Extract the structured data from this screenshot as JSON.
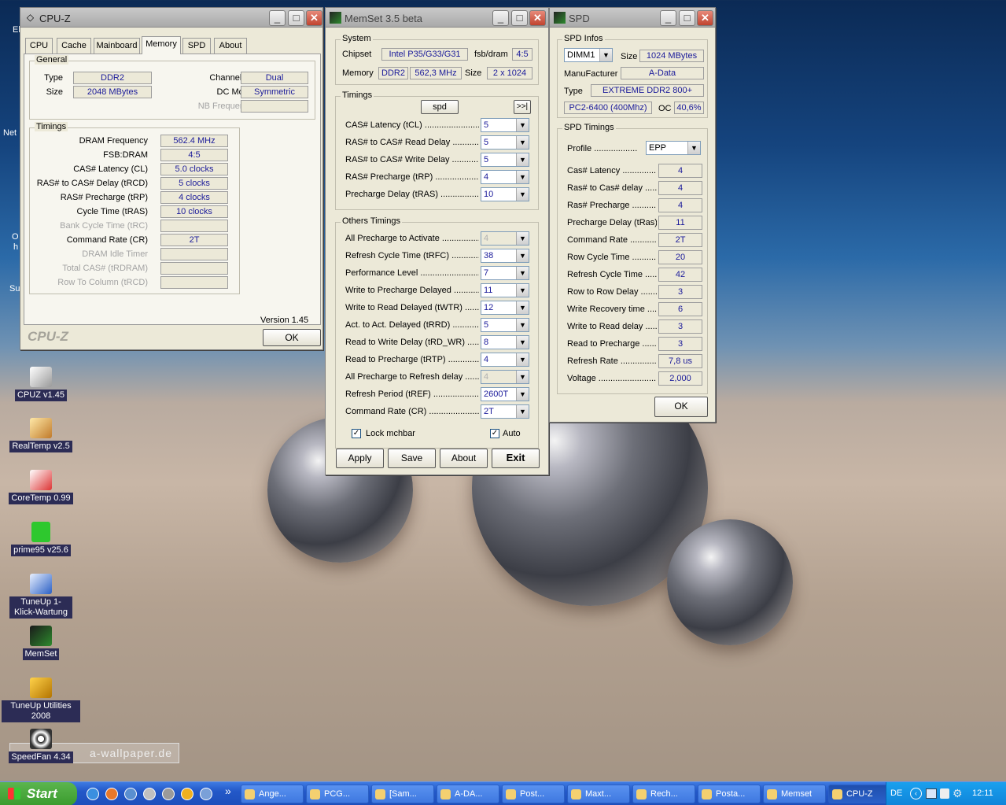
{
  "desktop": {
    "watermark": "a-wallpaper.de",
    "icons": [
      {
        "label": "CPUZ v1.45",
        "icon": "cpuz-icon"
      },
      {
        "label": "RealTemp v2.5",
        "icon": "realtemp-icon"
      },
      {
        "label": "CoreTemp 0.99",
        "icon": "coretemp-icon"
      },
      {
        "label": "prime95 v25.6",
        "icon": "prime95-icon"
      },
      {
        "label": "TuneUp 1-Klick-Wartung",
        "icon": "tuneup-icon"
      },
      {
        "label": "MemSet",
        "icon": "memset-icon"
      },
      {
        "label": "TuneUp Utilities 2008",
        "icon": "tuneup-utilities-icon"
      },
      {
        "label": "SpeedFan 4.34",
        "icon": "speedfan-icon"
      }
    ],
    "edge_fragments": [
      "El",
      "Net",
      "O",
      "h",
      "Su"
    ]
  },
  "cpuz": {
    "title": "CPU-Z",
    "tabs": [
      "CPU",
      "Cache",
      "Mainboard",
      "Memory",
      "SPD",
      "About"
    ],
    "active_tab": "Memory",
    "general": {
      "legend": "General",
      "type_label": "Type",
      "type": "DDR2",
      "size_label": "Size",
      "size": "2048 MBytes",
      "channels_label": "Channels #",
      "channels": "Dual",
      "dcmode_label": "DC Mode",
      "dcmode": "Symmetric",
      "nbfreq_label": "NB Frequency",
      "nbfreq": ""
    },
    "timings": {
      "legend": "Timings",
      "rows": [
        {
          "label": "DRAM Frequency",
          "value": "562.4 MHz",
          "enabled": true
        },
        {
          "label": "FSB:DRAM",
          "value": "4:5",
          "enabled": true
        },
        {
          "label": "CAS# Latency (CL)",
          "value": "5.0 clocks",
          "enabled": true
        },
        {
          "label": "RAS# to CAS# Delay (tRCD)",
          "value": "5 clocks",
          "enabled": true
        },
        {
          "label": "RAS# Precharge (tRP)",
          "value": "4 clocks",
          "enabled": true
        },
        {
          "label": "Cycle Time (tRAS)",
          "value": "10 clocks",
          "enabled": true
        },
        {
          "label": "Bank Cycle Time (tRC)",
          "value": "",
          "enabled": false
        },
        {
          "label": "Command Rate (CR)",
          "value": "2T",
          "enabled": true
        },
        {
          "label": "DRAM Idle Timer",
          "value": "",
          "enabled": false
        },
        {
          "label": "Total CAS# (tRDRAM)",
          "value": "",
          "enabled": false
        },
        {
          "label": "Row To Column (tRCD)",
          "value": "",
          "enabled": false
        }
      ]
    },
    "version": "Version 1.45",
    "brand": "CPU-Z",
    "ok": "OK"
  },
  "memset": {
    "title": "MemSet 3.5 beta",
    "system": {
      "legend": "System",
      "chipset_label": "Chipset",
      "chipset": "Intel P35/G33/G31",
      "fsbdram_label": "fsb/dram",
      "fsbdram": "4:5",
      "memory_label": "Memory",
      "memory_type": "DDR2",
      "memory_freq": "562,3 MHz",
      "size_label": "Size",
      "size": "2 x 1024"
    },
    "timings": {
      "legend": "Timings",
      "spd_button": "spd",
      "more_button": ">>|",
      "rows": [
        {
          "label": "CAS# Latency (tCL)",
          "value": "5",
          "enabled": true
        },
        {
          "label": "RAS# to CAS# Read Delay",
          "value": "5",
          "enabled": true
        },
        {
          "label": "RAS# to CAS# Write Delay",
          "value": "5",
          "enabled": true
        },
        {
          "label": "RAS# Precharge (tRP)",
          "value": "4",
          "enabled": true
        },
        {
          "label": "Precharge Delay  (tRAS)",
          "value": "10",
          "enabled": true
        }
      ]
    },
    "others": {
      "legend": "Others Timings",
      "rows": [
        {
          "label": "All Precharge to Activate",
          "value": "4",
          "enabled": false
        },
        {
          "label": "Refresh Cycle Time (tRFC)",
          "value": "38",
          "enabled": true
        },
        {
          "label": "Performance Level",
          "value": "7",
          "enabled": true
        },
        {
          "label": "Write to Precharge Delayed",
          "value": "11",
          "enabled": true
        },
        {
          "label": "Write to Read Delayed (tWTR)",
          "value": "12",
          "enabled": true
        },
        {
          "label": "Act. to Act. Delayed (tRRD)",
          "value": "5",
          "enabled": true
        },
        {
          "label": "Read to Write Delay (tRD_WR)",
          "value": "8",
          "enabled": true
        },
        {
          "label": "Read to Precharge (tRTP)",
          "value": "4",
          "enabled": true
        },
        {
          "label": "All Precharge to Refresh delay",
          "value": "4",
          "enabled": false
        },
        {
          "label": "Refresh Period (tREF)",
          "value": "2600T",
          "enabled": true
        },
        {
          "label": "Command Rate (CR)",
          "value": "2T",
          "enabled": true
        }
      ],
      "lock_mchbar": "Lock mchbar",
      "auto": "Auto"
    },
    "buttons": {
      "apply": "Apply",
      "save": "Save",
      "about": "About",
      "exit": "Exit"
    }
  },
  "spd": {
    "title": "SPD",
    "infos": {
      "legend": "SPD Infos",
      "dimm": "DIMM1",
      "size_label": "Size",
      "size": "1024 MBytes",
      "manufacturer_label": "ManuFacturer",
      "manufacturer": "A-Data",
      "type_label": "Type",
      "type": "EXTREME DDR2 800+",
      "speed": "PC2-6400 (400Mhz)",
      "oc_label": "OC",
      "oc": "40,6%"
    },
    "timings": {
      "legend": "SPD Timings",
      "profile_label": "Profile",
      "profile": "EPP",
      "rows": [
        {
          "label": "Cas# Latency",
          "value": "4"
        },
        {
          "label": "Ras# to Cas# delay",
          "value": "4"
        },
        {
          "label": "Ras# Precharge",
          "value": "4"
        },
        {
          "label": "Precharge Delay (tRas)",
          "value": "11"
        },
        {
          "label": "Command Rate",
          "value": "2T"
        },
        {
          "label": "Row Cycle Time",
          "value": "20"
        },
        {
          "label": "Refresh Cycle Time",
          "value": "42"
        },
        {
          "label": "Row to Row Delay",
          "value": "3"
        },
        {
          "label": "Write Recovery time",
          "value": "6"
        },
        {
          "label": "Write to Read delay",
          "value": "3"
        },
        {
          "label": "Read to Precharge",
          "value": "3"
        },
        {
          "label": "Refresh Rate",
          "value": "7,8 us"
        },
        {
          "label": "Voltage",
          "value": "2,000"
        }
      ]
    },
    "ok": "OK"
  },
  "taskbar": {
    "start": "Start",
    "quicklaunch": [
      "ie-icon",
      "firefox-icon",
      "thunderbird-icon",
      "network-icon",
      "tools-icon",
      "info-icon",
      "gear-icon"
    ],
    "overflow": "»",
    "tasks": [
      {
        "label": "Ange...",
        "active": false
      },
      {
        "label": "PCG...",
        "active": false
      },
      {
        "label": "[Sam...",
        "active": false
      },
      {
        "label": "A-DA...",
        "active": false
      },
      {
        "label": "Post...",
        "active": false
      },
      {
        "label": "Maxt...",
        "active": false
      },
      {
        "label": "Rech...",
        "active": false
      },
      {
        "label": "Posta...",
        "active": false
      },
      {
        "label": "Memset",
        "active": false
      },
      {
        "label": "CPU-Z",
        "active": true
      }
    ],
    "language": "DE",
    "clock": "12:11"
  }
}
